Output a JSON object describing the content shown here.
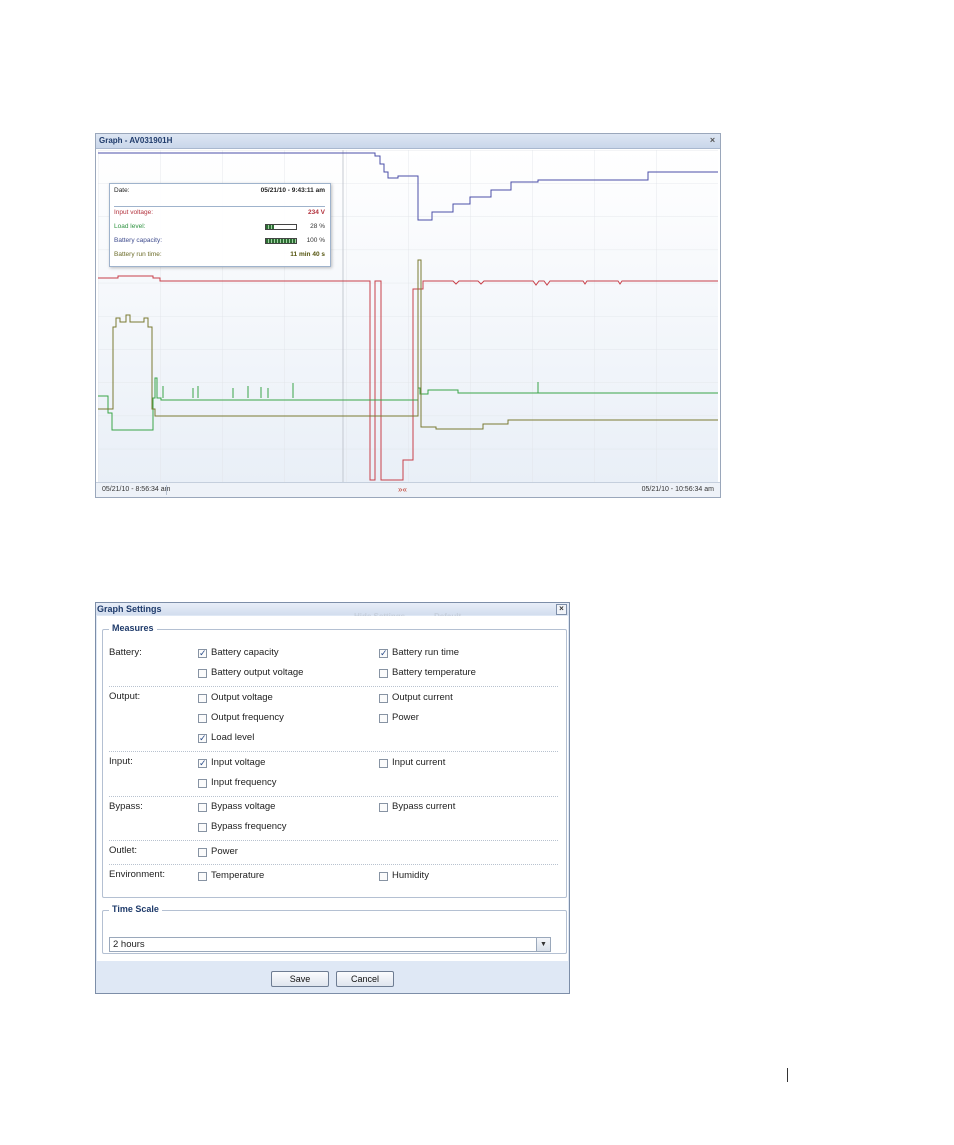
{
  "graph": {
    "title": "Graph - AV031901H",
    "close_icon": "×",
    "footer": {
      "start_time": "05/21/10 - 8:56:34 am",
      "end_time": "05/21/10 - 10:56:34 am",
      "zoom_icon": "»«"
    },
    "tooltip": {
      "date_label": "Date:",
      "date_value": "05/21/10 - 9:43:11 am",
      "input_voltage_label": "Input voltage:",
      "input_voltage_value": "234 V",
      "load_level_label": "Load level:",
      "load_level_value": "28 %",
      "load_level_fraction": 0.28,
      "battery_capacity_label": "Battery capacity:",
      "battery_capacity_value": "100 %",
      "battery_capacity_fraction": 1.0,
      "battery_runtime_label": "Battery run time:",
      "battery_runtime_value": "11 min 40 s"
    },
    "colors": {
      "battery_runtime": "#4b4fa8",
      "input_voltage": "#c8404a",
      "load_level": "#3aa548",
      "battery_capacity": "#7a7a32"
    }
  },
  "settings": {
    "title": "Graph Settings",
    "close_icon": "×",
    "ghost_left": "Hide Settings",
    "ghost_right": "Default",
    "measures_legend": "Measures",
    "battery": {
      "label": "Battery:",
      "capacity": "Battery capacity",
      "run_time": "Battery run time",
      "output_voltage": "Battery output voltage",
      "temperature": "Battery temperature"
    },
    "output": {
      "label": "Output:",
      "voltage": "Output voltage",
      "current": "Output current",
      "frequency": "Output frequency",
      "power": "Power",
      "load_level": "Load level"
    },
    "input": {
      "label": "Input:",
      "voltage": "Input voltage",
      "current": "Input current",
      "frequency": "Input frequency"
    },
    "bypass": {
      "label": "Bypass:",
      "voltage": "Bypass voltage",
      "current": "Bypass current",
      "frequency": "Bypass frequency"
    },
    "outlet": {
      "label": "Outlet:",
      "power": "Power"
    },
    "environment": {
      "label": "Environment:",
      "temperature": "Temperature",
      "humidity": "Humidity"
    },
    "checked_mark": "✓",
    "time_scale_legend": "Time Scale",
    "time_scale_value": "2 hours",
    "dropdown_icon": "▼",
    "save_label": "Save",
    "cancel_label": "Cancel"
  }
}
